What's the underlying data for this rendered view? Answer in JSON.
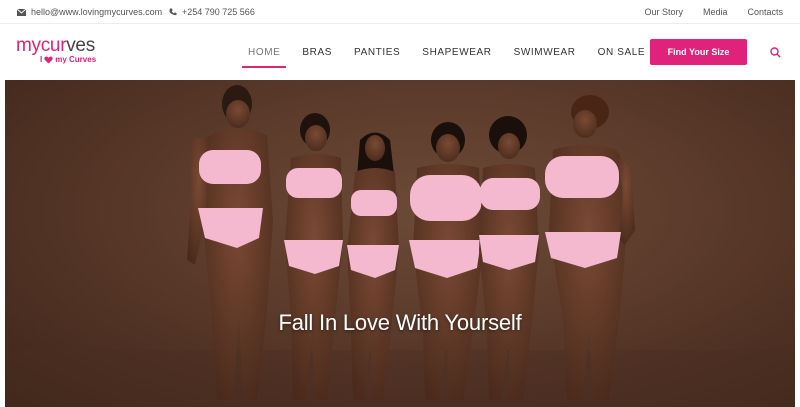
{
  "topbar": {
    "email": "hello@www.lovingmycurves.com",
    "phone": "+254 790 725 566",
    "links": [
      "Our Story",
      "Media",
      "Contacts"
    ]
  },
  "logo": {
    "part1": "mycur",
    "part2": "ves",
    "tagline_left": "I",
    "tagline_right": "my Curves"
  },
  "nav": {
    "items": [
      "HOME",
      "BRAS",
      "PANTIES",
      "SHAPEWEAR",
      "SWIMWEAR",
      "ON SALE"
    ],
    "active": "HOME"
  },
  "cta": {
    "label": "Find Your Size"
  },
  "hero": {
    "title": "Fall In Love With Yourself"
  },
  "colors": {
    "accent": "#e0227a",
    "hero_bg": "#5a3a2a",
    "lingerie": "#f4b8cf"
  },
  "icons": [
    "envelope-icon",
    "phone-icon",
    "search-icon",
    "heart-icon"
  ]
}
